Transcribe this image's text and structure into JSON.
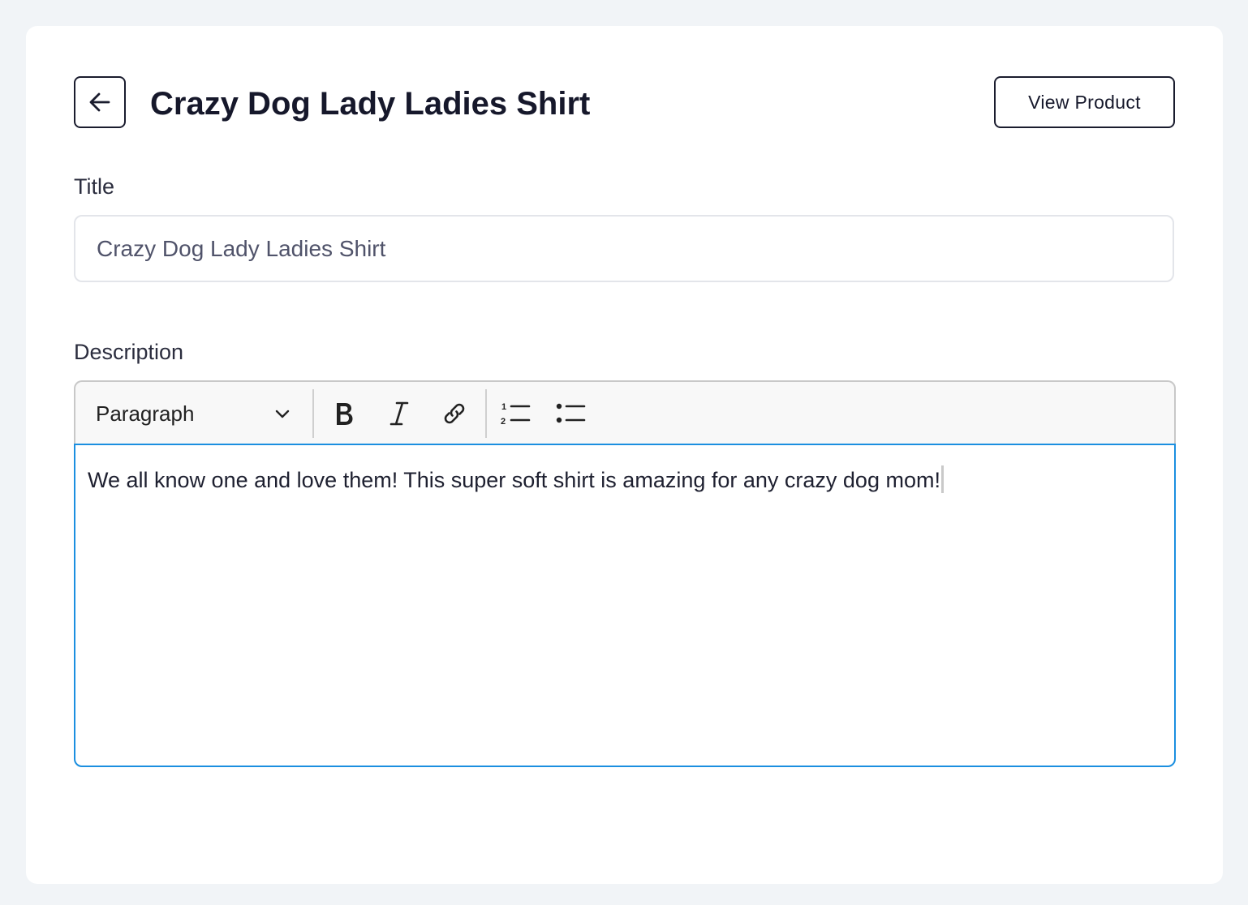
{
  "header": {
    "back_icon": "arrow-left-icon",
    "title": "Crazy Dog Lady Ladies Shirt",
    "view_product_label": "View Product"
  },
  "form": {
    "title_label": "Title",
    "title_value": "Crazy Dog Lady Ladies Shirt",
    "description_label": "Description"
  },
  "editor": {
    "format_value": "Paragraph",
    "toolbar_icons": [
      "chevron-down-icon",
      "bold-icon",
      "italic-icon",
      "link-icon",
      "numbered-list-icon",
      "bulleted-list-icon"
    ],
    "content": "We all know one and love them! This super soft shirt is amazing for any crazy dog mom!"
  },
  "colors": {
    "page_background": "#f1f4f7",
    "card_background": "#ffffff",
    "text_dark": "#16182b",
    "editor_focus_border": "#1b8fe0",
    "toolbar_background": "#f8f8f8"
  }
}
